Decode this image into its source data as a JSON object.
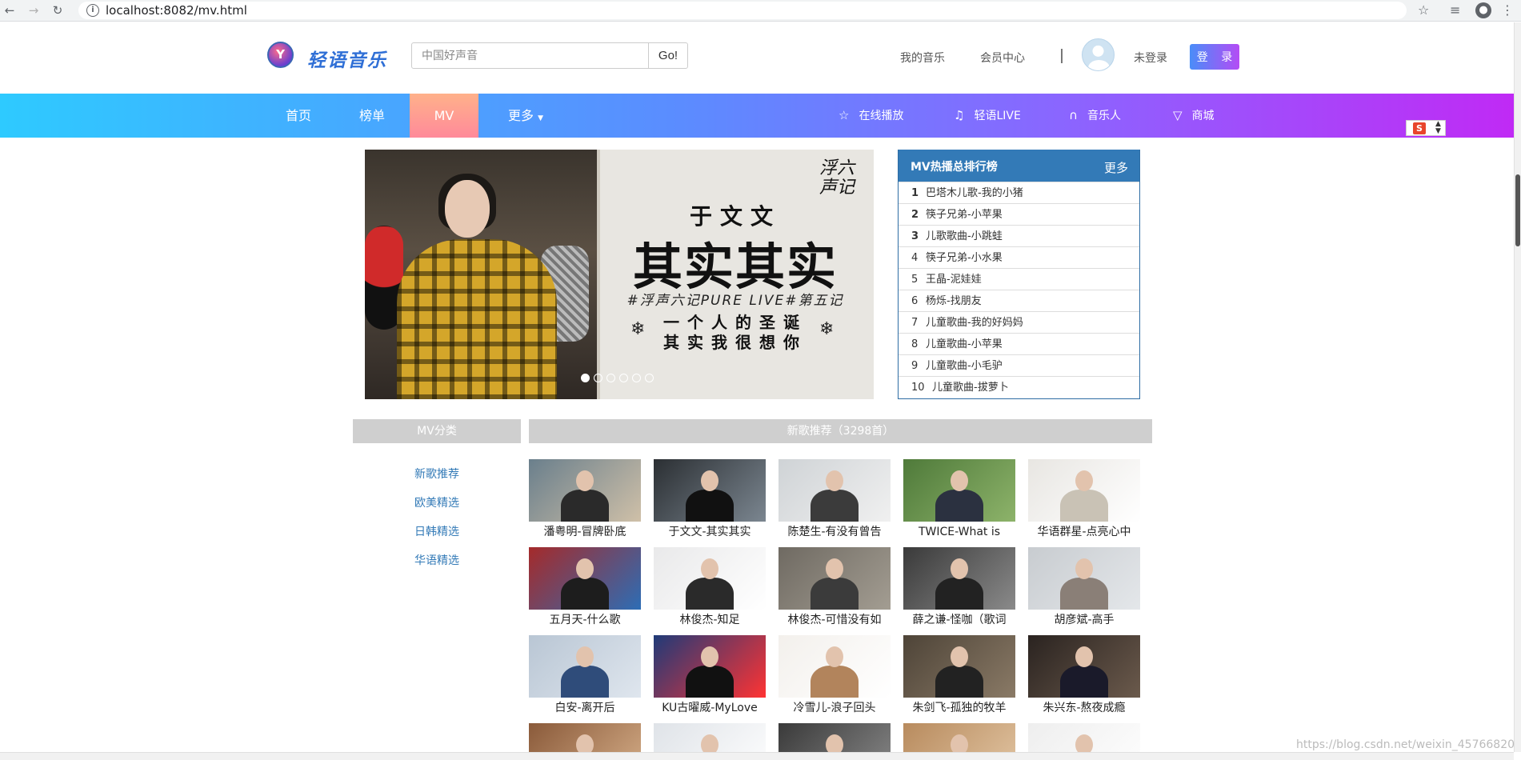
{
  "browser": {
    "url": "localhost:8082/mv.html"
  },
  "header": {
    "logo_text": "轻语音乐",
    "search_placeholder": "中国好声音",
    "search_button": "Go!",
    "links": [
      "我的音乐",
      "会员中心"
    ],
    "user_status": "未登录",
    "login_button": "登 录"
  },
  "nav": {
    "items": [
      "首页",
      "榜单",
      "MV",
      "更多"
    ],
    "active": "MV",
    "right_items": [
      {
        "icon": "star-icon",
        "label": "在线播放"
      },
      {
        "icon": "music-note-icon",
        "label": "轻语LIVE"
      },
      {
        "icon": "headphones-icon",
        "label": "音乐人"
      },
      {
        "icon": "cart-icon",
        "label": "商城"
      }
    ]
  },
  "banner": {
    "seal": "浮六声记",
    "artist": "于文文",
    "song": "其实其实",
    "tag": "#浮声六记PURE LIVE#第五记",
    "line1": "一个人的圣诞",
    "line2": "其实我很想你",
    "slide_count": 6,
    "active_slide": 1
  },
  "rank": {
    "title": "MV热播总排行榜",
    "more": "更多",
    "items": [
      {
        "num": "1",
        "name": "巴塔木儿歌-我的小猪"
      },
      {
        "num": "2",
        "name": "筷子兄弟-小苹果"
      },
      {
        "num": "3",
        "name": "儿歌歌曲-小跳蛙"
      },
      {
        "num": "4",
        "name": "筷子兄弟-小水果"
      },
      {
        "num": "5",
        "name": "王晶-泥娃娃"
      },
      {
        "num": "6",
        "name": "杨烁-找朋友"
      },
      {
        "num": "7",
        "name": "儿童歌曲-我的好妈妈"
      },
      {
        "num": "8",
        "name": "儿童歌曲-小苹果"
      },
      {
        "num": "9",
        "name": "儿童歌曲-小毛驴"
      },
      {
        "num": "10",
        "name": "儿童歌曲-拔萝卜"
      }
    ]
  },
  "categories": {
    "title": "MV分类",
    "items": [
      "新歌推荐",
      "欧美精选",
      "日韩精选",
      "华语精选"
    ]
  },
  "recommend": {
    "title": "新歌推荐（3298首）",
    "items": [
      "潘粤明-冒牌卧底",
      "于文文-其实其实",
      "陈楚生-有没有曾告",
      "TWICE-What is",
      "华语群星-点亮心中",
      "五月天-什么歌",
      "林俊杰-知足",
      "林俊杰-可惜没有如",
      "薛之谦-怪咖（歌词",
      "胡彦斌-高手",
      "白安-离开后",
      "KU古曜威-MyLove",
      "冷雪儿-浪子回头",
      "朱剑飞-孤独的牧羊",
      "朱兴东-熬夜成瘾"
    ]
  },
  "watermark": "https://blog.csdn.net/weixin_45766820"
}
